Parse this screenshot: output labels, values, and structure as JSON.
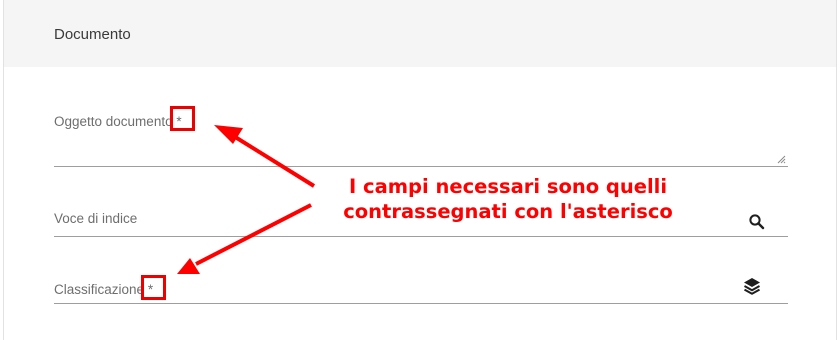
{
  "card": {
    "title": "Documento"
  },
  "fields": [
    {
      "label": "Oggetto documento",
      "required_marker": "*",
      "icon": "resize-handle-icon"
    },
    {
      "label": "Voce di indice",
      "icon": "search-icon"
    },
    {
      "label": "Classificazione",
      "required_marker": "*",
      "icon": "layers-icon"
    }
  ],
  "annotation": {
    "line1": "I campi necessari sono quelli",
    "line2": "contrassegnati con l'asterisco",
    "color": "#ff0000"
  }
}
